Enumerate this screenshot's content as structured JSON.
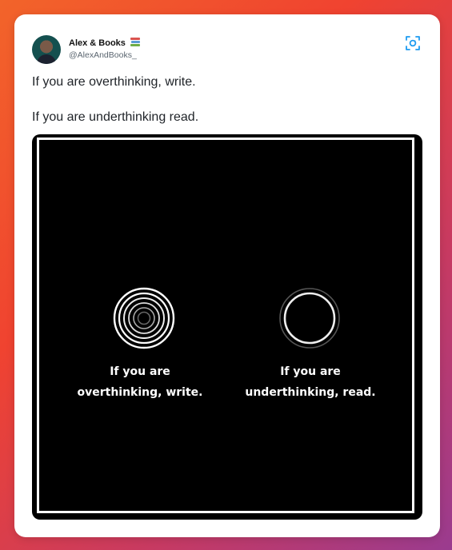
{
  "tweet": {
    "author_name": "Alex & Books",
    "author_emoji_icon": "books-emoji-icon",
    "author_handle": "@AlexAndBooks_",
    "lines": [
      "If you are overthinking, write.",
      "If you are underthinking read."
    ],
    "action_icon": "grok-scan-icon"
  },
  "image": {
    "left_caption_line1": "If you are",
    "left_caption_line2": "overthinking, write.",
    "right_caption_line1": "If you are",
    "right_caption_line2": "underthinking, read.",
    "left_symbol_icon": "concentric-circles-icon",
    "right_symbol_icon": "single-circle-icon"
  },
  "colors": {
    "background_gradient_start": "#f2642a",
    "background_gradient_end": "#9a3b8f",
    "card": "#ffffff",
    "media_bg": "#000000"
  }
}
